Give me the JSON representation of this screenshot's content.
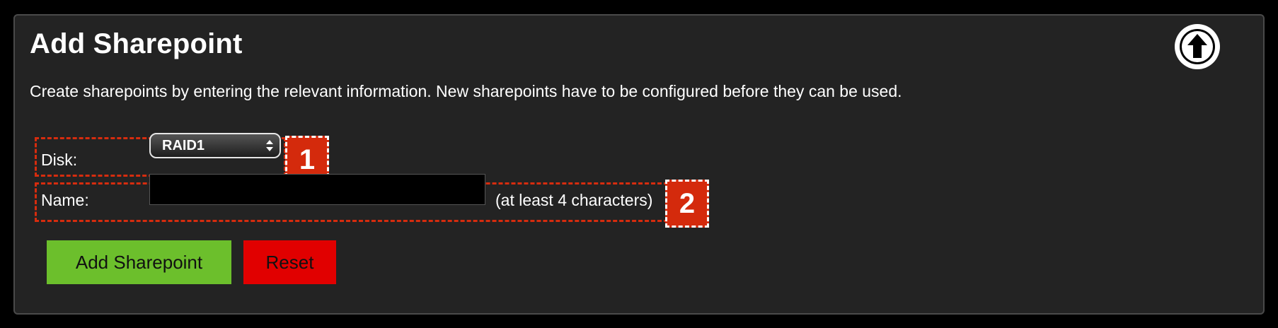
{
  "panel": {
    "title": "Add Sharepoint",
    "description": "Create sharepoints by entering the relevant information. New sharepoints have to be configured before they can be used.",
    "upload_icon": "arrow-up-circle-icon"
  },
  "form": {
    "disk_label": "Disk:",
    "disk_value": "RAID1",
    "name_label": "Name:",
    "name_value": "",
    "name_hint": "(at least 4 characters)"
  },
  "callouts": {
    "marker_1": "1",
    "marker_2": "2",
    "color": "#d42a0c"
  },
  "buttons": {
    "add_label": "Add Sharepoint",
    "add_color": "#6cbf2c",
    "reset_label": "Reset",
    "reset_color": "#e10000"
  }
}
